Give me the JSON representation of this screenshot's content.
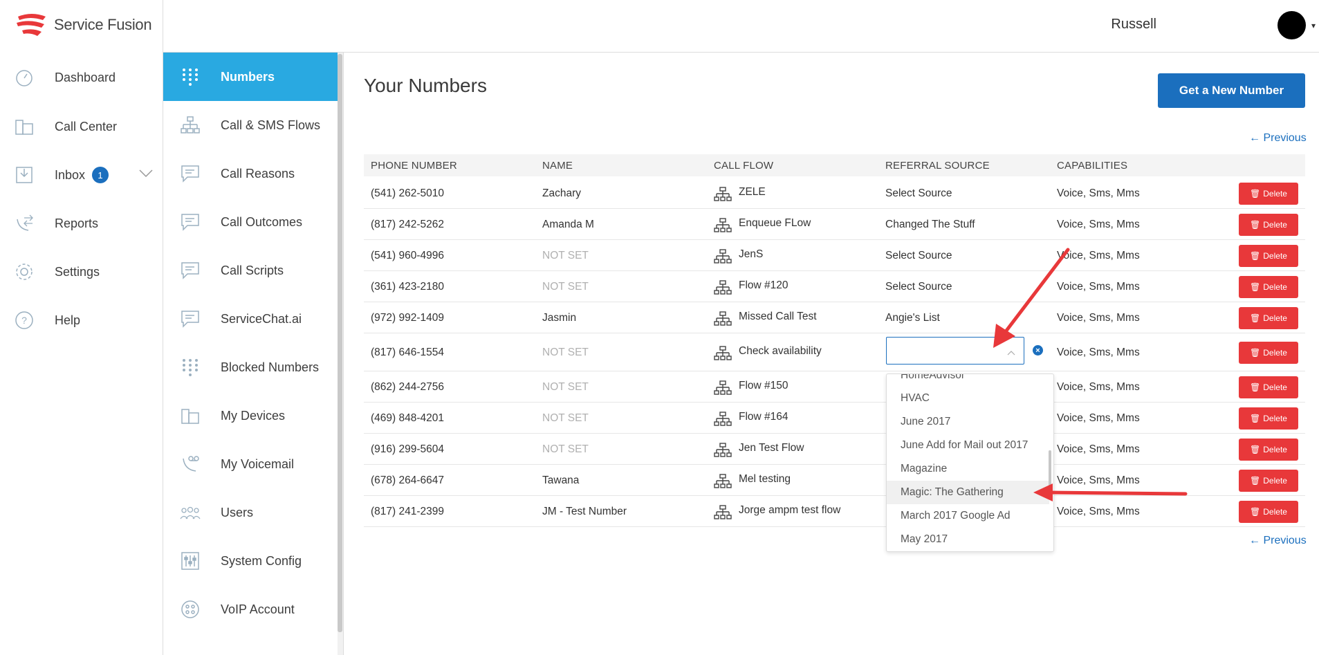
{
  "brand": {
    "name": "Service Fusion"
  },
  "topbar": {
    "username": "Russell"
  },
  "nav": {
    "items": [
      {
        "label": "Dashboard"
      },
      {
        "label": "Call Center"
      },
      {
        "label": "Inbox",
        "badge": "1"
      },
      {
        "label": "Reports"
      },
      {
        "label": "Settings"
      },
      {
        "label": "Help"
      }
    ]
  },
  "subnav": {
    "items": [
      {
        "label": "Numbers",
        "active": true
      },
      {
        "label": "Call & SMS Flows"
      },
      {
        "label": "Call Reasons"
      },
      {
        "label": "Call Outcomes"
      },
      {
        "label": "Call Scripts"
      },
      {
        "label": "ServiceChat.ai"
      },
      {
        "label": "Blocked Numbers"
      },
      {
        "label": "My Devices"
      },
      {
        "label": "My Voicemail"
      },
      {
        "label": "Users"
      },
      {
        "label": "System Config"
      },
      {
        "label": "VoIP Account"
      }
    ]
  },
  "main": {
    "title": "Your Numbers",
    "get_number_label": "Get a New Number",
    "previous_label": "← Previous",
    "columns": [
      "PHONE NUMBER",
      "NAME",
      "CALL FLOW",
      "REFERRAL SOURCE",
      "CAPABILITIES"
    ],
    "delete_label": "Delete",
    "rows": [
      {
        "phone": "(541) 262-5010",
        "name": "Zachary",
        "flow": "ZELE",
        "source": "Select Source",
        "caps": "Voice, Sms, Mms"
      },
      {
        "phone": "(817) 242-5262",
        "name": "Amanda M",
        "flow": "Enqueue FLow",
        "source": "Changed The Stuff",
        "caps": "Voice, Sms, Mms"
      },
      {
        "phone": "(541) 960-4996",
        "name": "NOT SET",
        "flow": "JenS",
        "source": "Select Source",
        "caps": "Voice, Sms, Mms"
      },
      {
        "phone": "(361) 423-2180",
        "name": "NOT SET",
        "flow": "Flow #120",
        "source": "Select Source",
        "caps": "Voice, Sms, Mms"
      },
      {
        "phone": "(972) 992-1409",
        "name": "Jasmin",
        "flow": "Missed Call Test",
        "source": "Angie's List",
        "caps": "Voice, Sms, Mms"
      },
      {
        "phone": "(817) 646-1554",
        "name": "NOT SET",
        "flow": "Check availability",
        "source": "",
        "caps": "Voice, Sms, Mms"
      },
      {
        "phone": "(862) 244-2756",
        "name": "NOT SET",
        "flow": "Flow #150",
        "source": "",
        "caps": "Voice, Sms, Mms"
      },
      {
        "phone": "(469) 848-4201",
        "name": "NOT SET",
        "flow": "Flow #164",
        "source": "",
        "caps": "Voice, Sms, Mms"
      },
      {
        "phone": "(916) 299-5604",
        "name": "NOT SET",
        "flow": "Jen Test Flow",
        "source": "",
        "caps": "Voice, Sms, Mms"
      },
      {
        "phone": "(678) 264-6647",
        "name": "Tawana",
        "flow": "Mel testing",
        "source": "",
        "caps": "Voice, Sms, Mms"
      },
      {
        "phone": "(817) 241-2399",
        "name": "JM - Test Number",
        "flow": "Jorge ampm test flow",
        "source": "",
        "caps": "Voice, Sms, Mms"
      }
    ],
    "dropdown": {
      "options": [
        "HomeAdvisor",
        "HVAC",
        "June 2017",
        "June Add for Mail out 2017",
        "Magazine",
        "Magic: The Gathering",
        "March 2017 Google Ad",
        "May 2017"
      ],
      "highlighted": "Magic: The Gathering"
    }
  },
  "colors": {
    "accent": "#1b6fbe",
    "active_nav": "#29a9e1",
    "danger": "#e8383a",
    "annotation": "#e8383a"
  }
}
